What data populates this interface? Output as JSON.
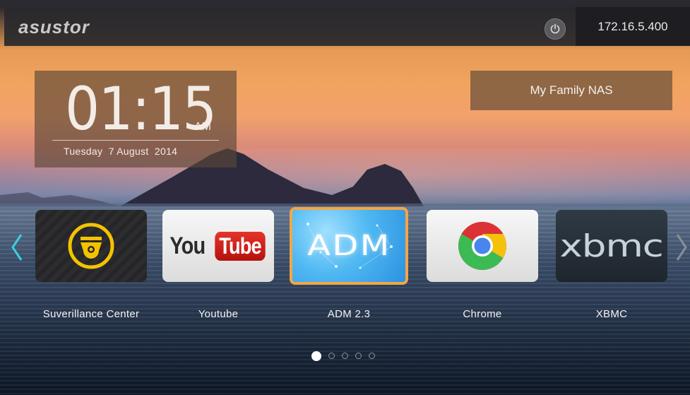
{
  "topbar": {
    "logo": "asustor",
    "ip_address": "172.16.5.400"
  },
  "clock": {
    "time": "01:15",
    "ampm": "AM",
    "date": "Tuesday  7 August  2014"
  },
  "nas_name": "My Family NAS",
  "apps": [
    {
      "label": "Suverillance Center",
      "icon": "surveillance-camera-icon"
    },
    {
      "label": "Youtube",
      "icon": "youtube-icon",
      "logo_you": "You",
      "logo_tube": "Tube"
    },
    {
      "label": "ADM 2.3",
      "icon": "adm-icon",
      "logo": "ADM"
    },
    {
      "label": "Chrome",
      "icon": "chrome-icon"
    },
    {
      "label": "XBMC",
      "icon": "xbmc-icon",
      "logo": "xbmc"
    }
  ],
  "pagination": {
    "pages": 5,
    "active": 1
  },
  "colors": {
    "accent_selected": "#f2a646",
    "arrow": "#3ad1dd"
  }
}
